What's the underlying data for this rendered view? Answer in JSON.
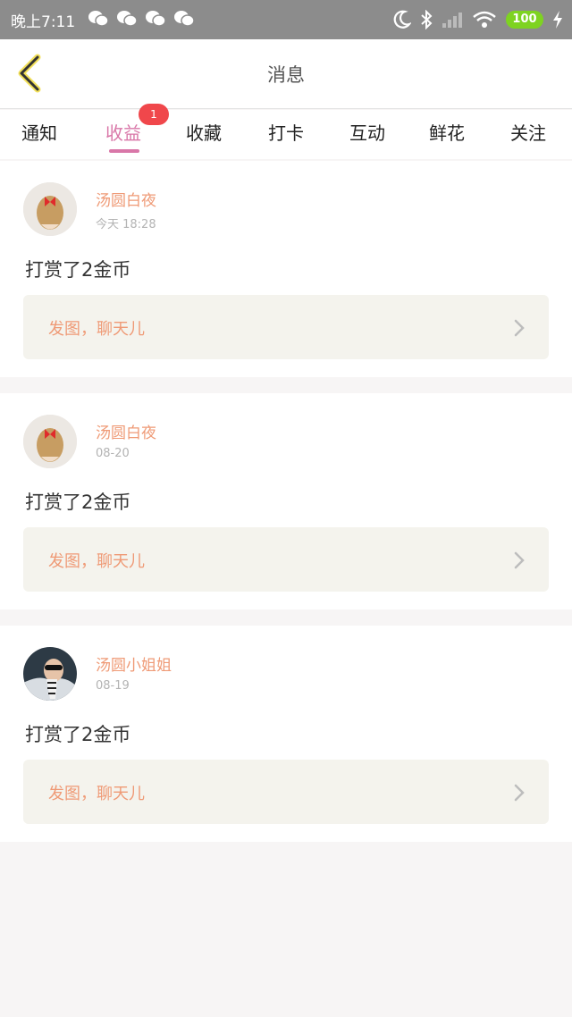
{
  "status_bar": {
    "time": "晚上7:11",
    "battery": "100"
  },
  "header": {
    "title": "消息"
  },
  "tabs": [
    {
      "label": "通知"
    },
    {
      "label": "收益",
      "badge": "1"
    },
    {
      "label": "收藏"
    },
    {
      "label": "打卡"
    },
    {
      "label": "互动"
    },
    {
      "label": "鲜花"
    },
    {
      "label": "关注"
    }
  ],
  "active_tab": "收益",
  "messages": [
    {
      "author": "汤圆白夜",
      "time": "今天 18:28",
      "text": "打赏了2金币",
      "reply_label": "发图，聊天儿"
    },
    {
      "author": "汤圆白夜",
      "time": "08-20",
      "text": "打赏了2金币",
      "reply_label": "发图，聊天儿"
    },
    {
      "author": "汤圆小姐姐",
      "time": "08-19",
      "text": "打赏了2金币",
      "reply_label": "发图，聊天儿"
    }
  ],
  "colors": {
    "accent_pink": "#d977a8",
    "author_orange": "#ef9a76",
    "badge_red": "#f0474b",
    "status_bar_gray": "#8c8c8c"
  }
}
